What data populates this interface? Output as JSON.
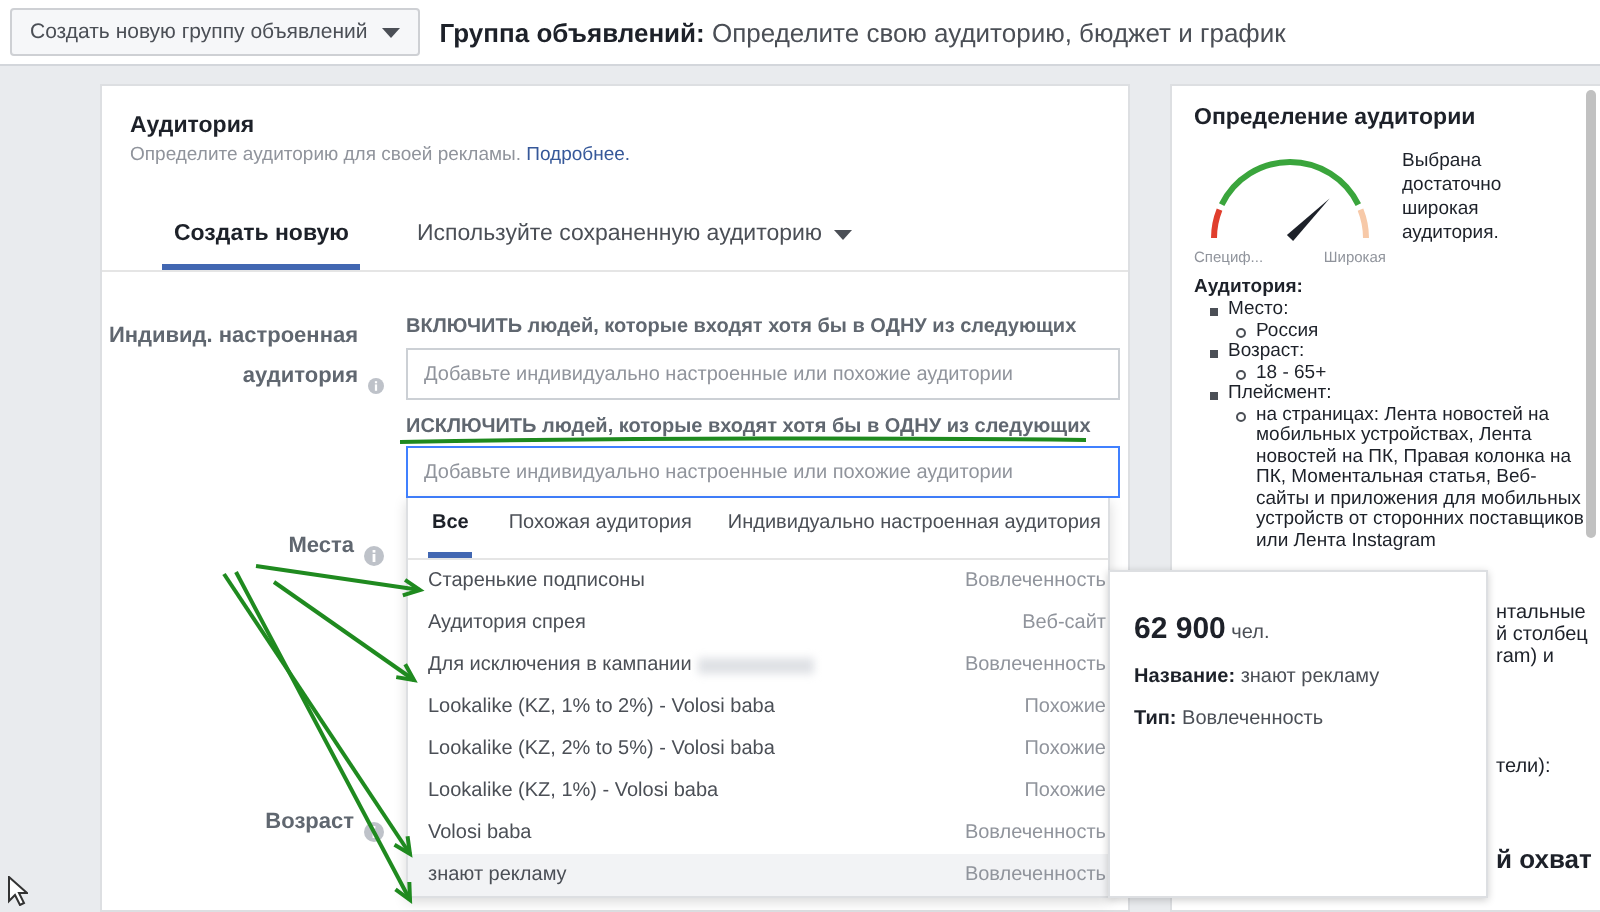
{
  "top_bar": {
    "button": "Создать новую группу объявлений",
    "title_bold": "Группа объявлений:",
    "title": "Определите свою аудиторию, бюджет и график"
  },
  "audience": {
    "title": "Аудитория",
    "subtitle": "Определите аудиторию для своей рекламы.",
    "link": "Подробнее.",
    "tabs": [
      {
        "label": "Создать новую",
        "selected": true,
        "dropdown": false
      },
      {
        "label": "Используйте сохраненную аудиторию",
        "selected": false,
        "dropdown": true
      }
    ]
  },
  "custom_audience": {
    "label": "Индивид. настроенная аудитория",
    "include_heading": "ВКЛЮЧИТЬ людей, которые входят хотя бы в ОДНУ из следующих",
    "include_placeholder": "Добавьте индивидуально настроенные или похожие аудитории",
    "exclude_heading": "ИСКЛЮЧИТЬ людей, которые входят хотя бы в ОДНУ из следующих",
    "exclude_placeholder": "Добавьте индивидуально настроенные или похожие аудитории"
  },
  "fields": [
    {
      "label": "Места"
    },
    {
      "label": "Возраст"
    }
  ],
  "dropdown": {
    "tabs": [
      {
        "label": "Все",
        "selected": true
      },
      {
        "label": "Похожая аудитория",
        "selected": false
      },
      {
        "label": "Индивидуально настроенная аудитория",
        "selected": false
      }
    ],
    "items": [
      {
        "name": "Старенькие подписоны",
        "type": "Вовлеченность",
        "selected": false,
        "blurred": false
      },
      {
        "name": "Аудитория спрея",
        "type": "Веб-сайт",
        "selected": false,
        "blurred": false
      },
      {
        "name": "Для исключения в кампании",
        "type": "Вовлеченность",
        "selected": false,
        "blurred": true
      },
      {
        "name": "Lookalike (KZ, 1% to 2%) - Volosi baba",
        "type": "Похожие",
        "selected": false,
        "blurred": false
      },
      {
        "name": "Lookalike (KZ, 2% to 5%) - Volosi baba",
        "type": "Похожие",
        "selected": false,
        "blurred": false
      },
      {
        "name": "Lookalike (KZ, 1%) - Volosi baba",
        "type": "Похожие",
        "selected": false,
        "blurred": false
      },
      {
        "name": "Volosi baba",
        "type": "Вовлеченность",
        "selected": false,
        "blurred": false
      },
      {
        "name": "знают рекламу",
        "type": "Вовлеченность",
        "selected": true,
        "blurred": false
      }
    ]
  },
  "tooltip": {
    "count": "62 900",
    "unit": "чел.",
    "name_label": "Название:",
    "name": "знают рекламу",
    "type_label": "Тип:",
    "type": "Вовлеченность"
  },
  "definition": {
    "title": "Определение аудитории",
    "gauge": {
      "low_label": "Специф...",
      "high_label": "Широкая"
    },
    "verdict": "Выбрана достаточно широкая аудитория.",
    "heading": "Аудитория:",
    "criteria": [
      {
        "label": "Место:",
        "children": [
          {
            "label": "Россия"
          }
        ]
      },
      {
        "label": "Возраст:",
        "children": [
          {
            "label": "18 - 65+"
          }
        ]
      },
      {
        "label": "Плейсмент:",
        "children": [
          {
            "label": "на страницах: Лента новостей на мобильных устройствах, Лента новостей на ПК, Правая колонка на ПК, Моментальная статья, Веб-сайты и приложения для мобильных устройств от сторонних поставщиков или Лента Instagram"
          }
        ]
      }
    ],
    "covered_sections": [
      {
        "kind": "text",
        "lines": [
          "нтальные",
          "й столбец",
          "ram) и"
        ]
      },
      {
        "kind": "text",
        "lines": [
          "тели):"
        ]
      },
      {
        "kind": "heading",
        "lines": [
          "й охват"
        ]
      }
    ]
  }
}
